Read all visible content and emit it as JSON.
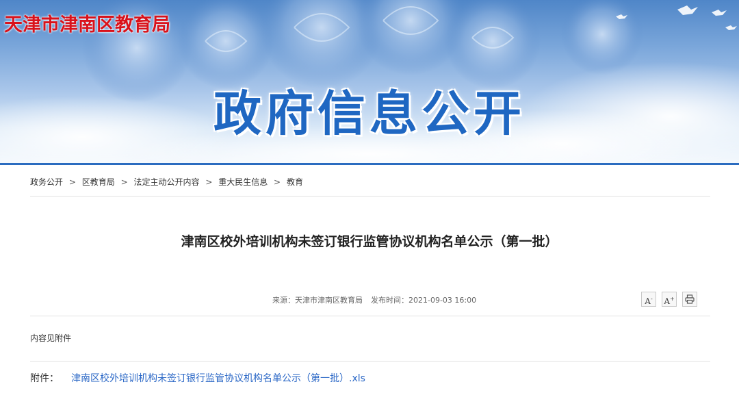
{
  "site": {
    "name": "天津市津南区教育局",
    "banner_title": "政府信息公开"
  },
  "breadcrumb": {
    "items": [
      "政务公开",
      "区教育局",
      "法定主动公开内容",
      "重大民生信息",
      "教育"
    ],
    "separator": ">"
  },
  "article": {
    "title": "津南区校外培训机构未签订银行监管协议机构名单公示（第一批）",
    "source_label": "来源：天津市津南区教育局",
    "publish_label": "发布时间：2021-09-03 16:00",
    "body": "内容见附件"
  },
  "tools": {
    "font_decrease": "A",
    "font_decrease_mark": "-",
    "font_increase": "A",
    "font_increase_mark": "+",
    "print_icon": "printer-icon"
  },
  "attachment": {
    "label": "附件：",
    "link_text": "津南区校外培训机构未签订银行监管协议机构名单公示（第一批）.xls"
  },
  "colors": {
    "site_name": "#d9121b",
    "banner_title": "#1f67c2",
    "link": "#2a67c6",
    "accent_line": "#2b6cc0"
  }
}
